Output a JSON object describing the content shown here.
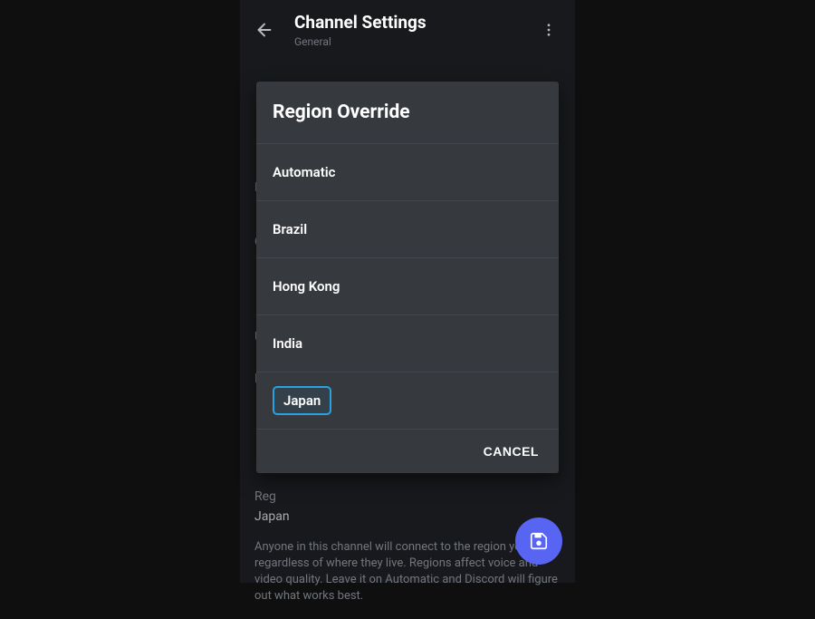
{
  "header": {
    "title": "Channel Settings",
    "subtitle": "General"
  },
  "background": {
    "letter_e": "E",
    "letter_c": "C",
    "letter_u": "U",
    "letter_n": "N",
    "region_label_partial": "Reg",
    "region_value": "Japan",
    "description": "Anyone in this channel will connect to the region you set regardless of where they live. Regions affect voice and video quality. Leave it on Automatic and Discord will figure out what works best."
  },
  "modal": {
    "title": "Region Override",
    "regions": [
      {
        "label": "Automatic",
        "selected": false
      },
      {
        "label": "Brazil",
        "selected": false
      },
      {
        "label": "Hong Kong",
        "selected": false
      },
      {
        "label": "India",
        "selected": false
      },
      {
        "label": "Japan",
        "selected": true
      }
    ],
    "cancel_label": "CANCEL"
  }
}
